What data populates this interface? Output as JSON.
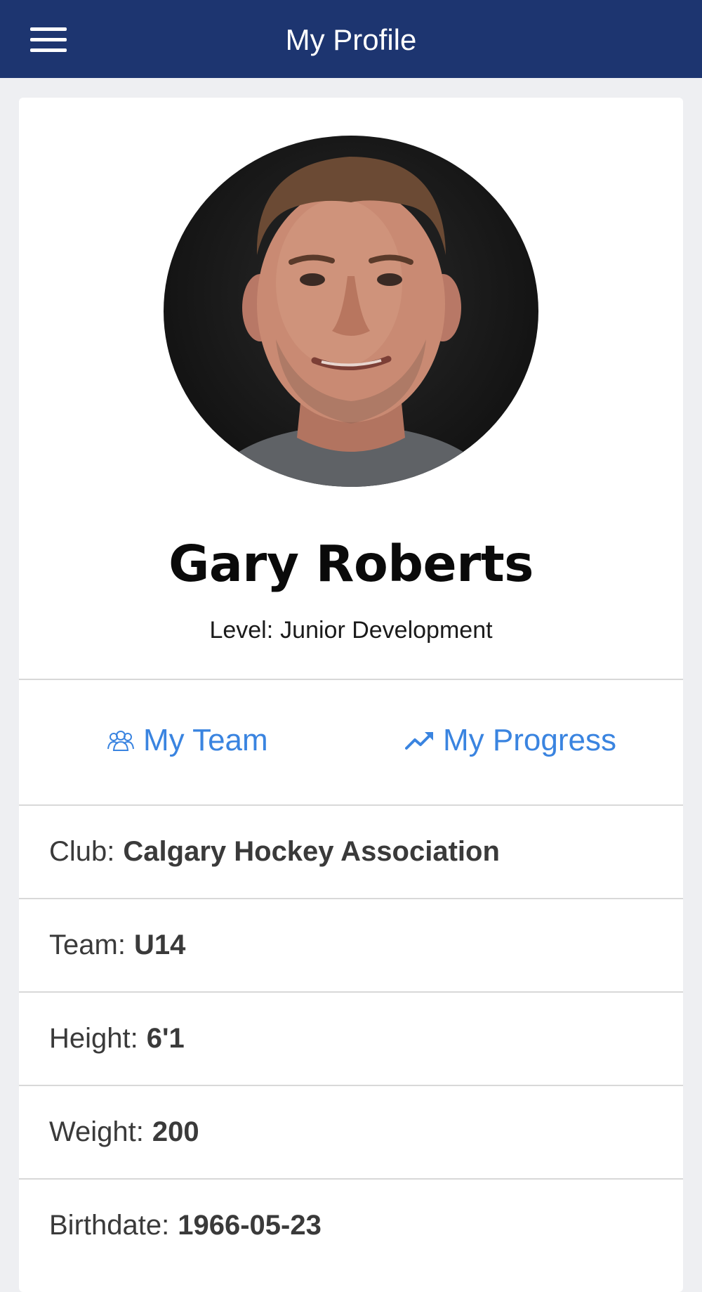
{
  "header": {
    "title": "My Profile",
    "menu_icon": "hamburger-menu-icon"
  },
  "profile": {
    "name": "Gary Roberts",
    "level_label": "Level:",
    "level_value": "Junior Development"
  },
  "quick_links": [
    {
      "label": "My Team",
      "icon": "team-icon"
    },
    {
      "label": "My Progress",
      "icon": "trending-up-icon"
    }
  ],
  "details": [
    {
      "label": "Club:",
      "value": "Calgary Hockey Association"
    },
    {
      "label": "Team:",
      "value": "U14"
    },
    {
      "label": "Height:",
      "value": "6'1"
    },
    {
      "label": "Weight:",
      "value": "200"
    },
    {
      "label": "Birthdate:",
      "value": "1966-05-23"
    }
  ],
  "colors": {
    "header_bg": "#1d3570",
    "link": "#3a84e0",
    "page_bg": "#eeeff2"
  }
}
